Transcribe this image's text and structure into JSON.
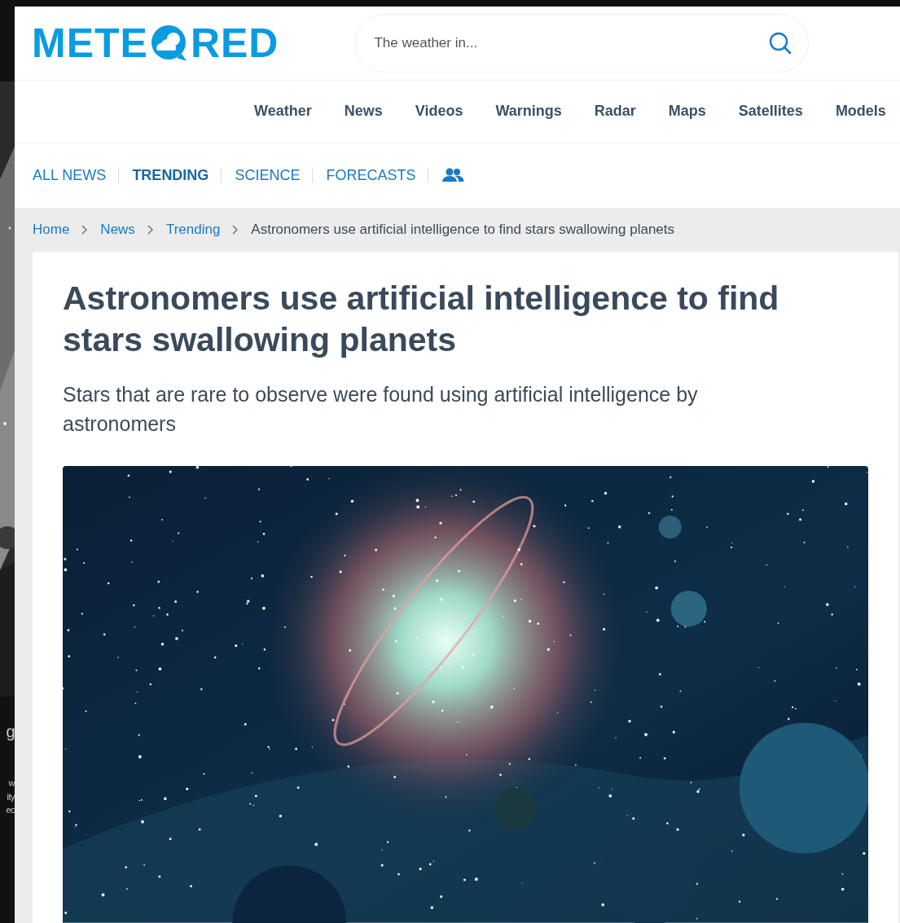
{
  "background_window": {
    "texts": [
      "g",
      "w",
      "ity",
      "ec"
    ]
  },
  "header": {
    "logo": {
      "before": "METE",
      "after": "RED"
    },
    "search": {
      "placeholder": "The weather in..."
    }
  },
  "nav": [
    {
      "label": "Weather"
    },
    {
      "label": "News"
    },
    {
      "label": "Videos"
    },
    {
      "label": "Warnings"
    },
    {
      "label": "Radar"
    },
    {
      "label": "Maps"
    },
    {
      "label": "Satellites"
    },
    {
      "label": "Models"
    }
  ],
  "sections": [
    {
      "label": "ALL NEWS",
      "selected": false
    },
    {
      "label": "TRENDING",
      "selected": true
    },
    {
      "label": "SCIENCE",
      "selected": false
    },
    {
      "label": "FORECASTS",
      "selected": false
    }
  ],
  "breadcrumb": [
    {
      "label": "Home",
      "current": false
    },
    {
      "label": "News",
      "current": false
    },
    {
      "label": "Trending",
      "current": false
    },
    {
      "label": "Astronomers use artificial intelligence to find stars swallowing planets",
      "current": true
    }
  ],
  "article": {
    "title": "Astronomers use artificial intelligence to find stars swallowing planets",
    "subtitle": "Stars that are rare to observe were found using artificial intelligence by astronomers"
  }
}
